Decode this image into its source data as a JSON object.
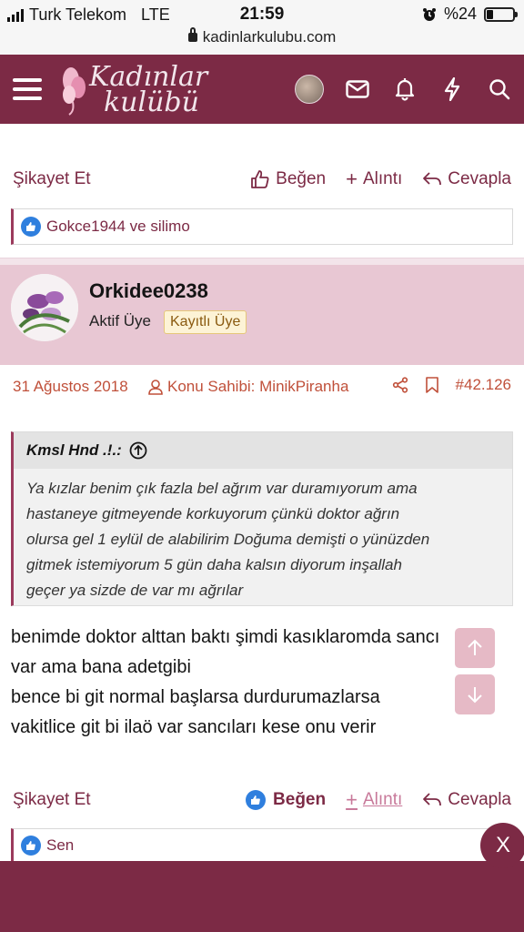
{
  "statusbar": {
    "carrier": "Turk Telekom",
    "network": "LTE",
    "time": "21:59",
    "battery": "%24",
    "battery_level": 0.24,
    "url": "kadinlarkulubu.com"
  },
  "header": {
    "logo_line1": "Kadınlar",
    "logo_line2": "kulübü",
    "icons": [
      "menu-icon",
      "avatar",
      "mail-icon",
      "bell-icon",
      "bolt-icon",
      "search-icon"
    ]
  },
  "prev_post": {
    "report": "Şikayet Et",
    "like": "Beğen",
    "quote": "Alıntı",
    "reply": "Cevapla",
    "reactions": "Gokce1944 ve silimo"
  },
  "post": {
    "username": "Orkidee0238",
    "user_title": "Aktif Üye",
    "badge": "Kayıtlı Üye",
    "date": "31 Ağustos 2018",
    "owner_label": "Konu Sahibi: MinikPiranha",
    "post_number": "#42.126",
    "quote": {
      "author": "Kmsl Hnd .!.:",
      "lines": [
        "Ya kızlar benim çık fazla bel ağrım var duramıyorum ama",
        "hastaneye gitmeyende korkuyorum çünkü doktor ağrın",
        "olursa gel 1 eylül de alabilirim Doğuma demişti o yünüzden",
        "gitmek istemiyorum 5 gün daha kalsın diyorum inşallah",
        "geçer ya sizde de var mı ağrılar"
      ]
    },
    "body_lines": [
      "benimde doktor alttan baktı şimdi kasıklaromda sancı",
      "var ama bana adetgibi",
      "bence bi git normal başlarsa durdurumazlarsa",
      "vakitlice git bi ilaö var sancıları kese onu verir"
    ],
    "report": "Şikayet Et",
    "like": "Beğen",
    "quote_btn": "Alıntı",
    "reply": "Cevapla",
    "reactions": "Sen"
  },
  "close_label": "X",
  "colors": {
    "brand": "#7c2a45",
    "post_header_bg": "#e8c7d3",
    "meta_text": "#c0503a",
    "like_blue": "#2f7fde"
  }
}
